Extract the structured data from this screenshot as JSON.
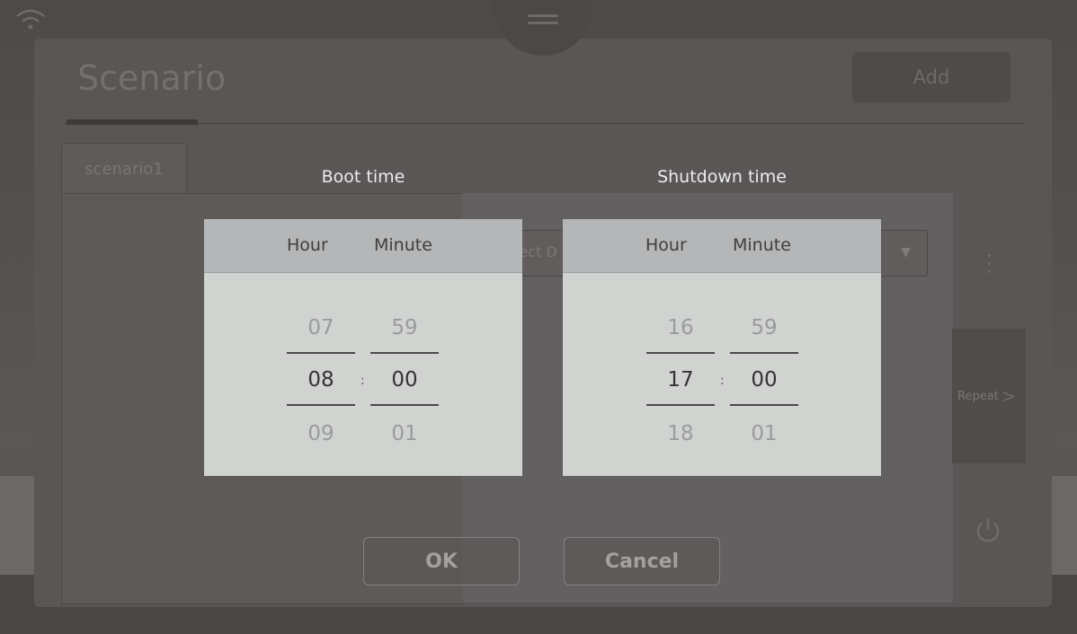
{
  "page": {
    "title": "Scenario",
    "add_label": "Add",
    "tab_label": "scenario1",
    "select_placeholder": "lect D",
    "repeat_label": "Repeat",
    "repeat_chevron": ">"
  },
  "dialog": {
    "boot": {
      "label": "Boot time",
      "hour_header": "Hour",
      "minute_header": "Minute",
      "hour_prev": "07",
      "hour_value": "08",
      "hour_next": "09",
      "minute_prev": "59",
      "minute_value": "00",
      "minute_next": "01"
    },
    "shutdown": {
      "label": "Shutdown time",
      "hour_header": "Hour",
      "minute_header": "Minute",
      "hour_prev": "16",
      "hour_value": "17",
      "hour_next": "18",
      "minute_prev": "59",
      "minute_value": "00",
      "minute_next": "01"
    },
    "separator": ":",
    "ok_label": "OK",
    "cancel_label": "Cancel"
  },
  "icons": {
    "wifi": "wifi-icon",
    "menu": "menu-handle-icon",
    "more": "kebab-icon",
    "dropdown": "triangle-down-icon",
    "power": "power-icon"
  }
}
